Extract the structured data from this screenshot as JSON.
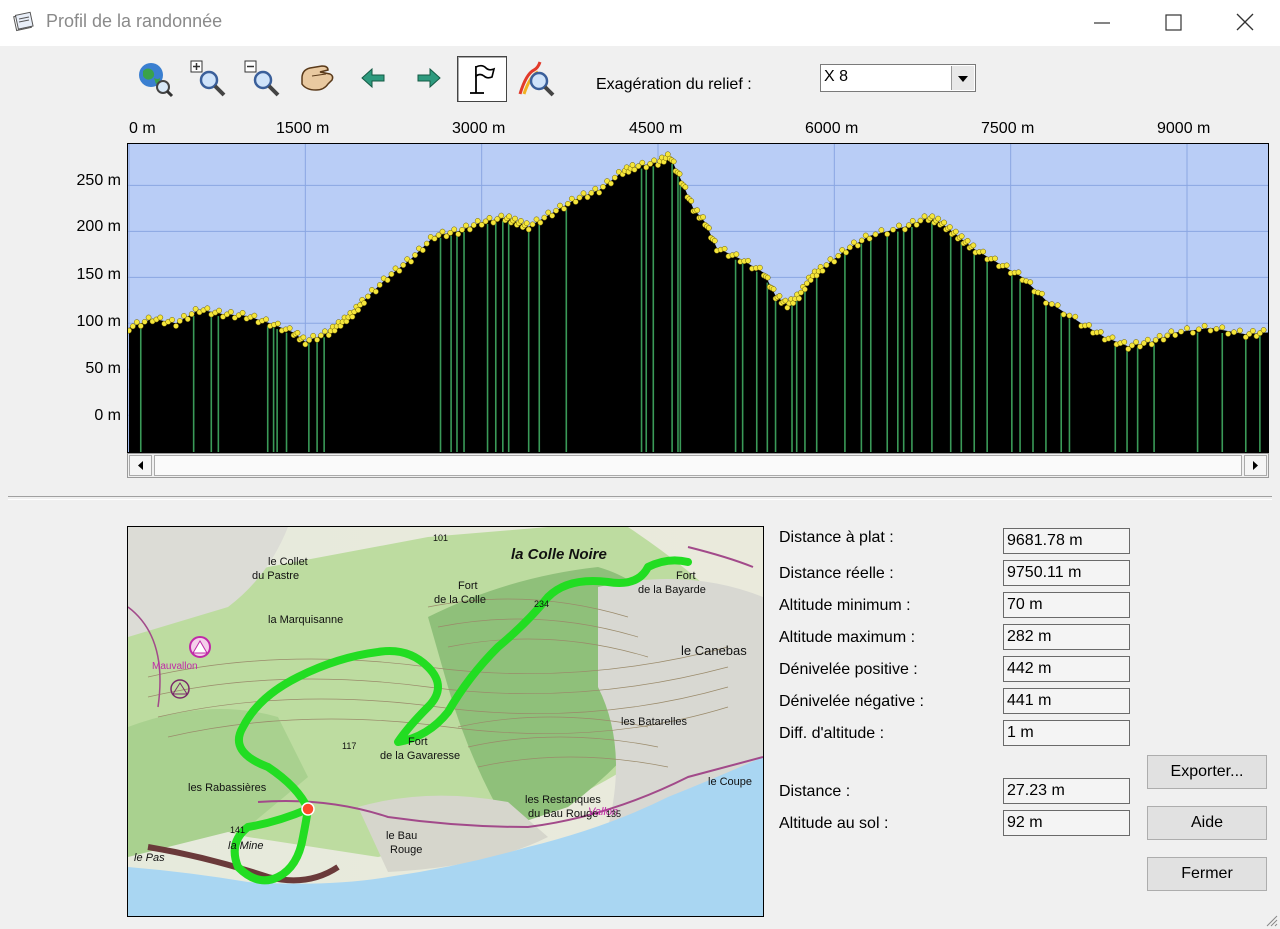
{
  "window": {
    "title": "Profil de la randonnée"
  },
  "toolbar": {
    "icons": [
      "globe-zoom-icon",
      "zoom-in-icon",
      "zoom-out-icon",
      "pan-hand-icon",
      "arrow-left-icon",
      "arrow-right-icon",
      "flag-icon",
      "path-search-icon"
    ],
    "relief_label": "Exagération du relief :",
    "relief_value": "X 8"
  },
  "profile": {
    "x_ticks": [
      "0 m",
      "1500 m",
      "3000 m",
      "4500 m",
      "6000 m",
      "7500 m",
      "9000 m"
    ],
    "y_ticks": [
      "250 m",
      "200 m",
      "150 m",
      "100 m",
      "50 m",
      "0 m"
    ]
  },
  "chart_data": {
    "type": "area",
    "xlabel": "",
    "ylabel": "",
    "xlim": [
      0,
      9681.78
    ],
    "ylim": [
      -40,
      295
    ],
    "x_ticks": [
      0,
      1500,
      3000,
      4500,
      6000,
      7500,
      9000
    ],
    "y_ticks": [
      0,
      50,
      100,
      150,
      200,
      250
    ],
    "grid": true,
    "x": [
      0,
      200,
      400,
      600,
      800,
      1000,
      1200,
      1400,
      1500,
      1700,
      1800,
      1900,
      2000,
      2200,
      2400,
      2600,
      2800,
      3000,
      3200,
      3300,
      3400,
      3600,
      3800,
      4000,
      4200,
      4300,
      4500,
      4600,
      4700,
      4800,
      4900,
      5000,
      5200,
      5400,
      5500,
      5600,
      5700,
      5800,
      5900,
      6100,
      6300,
      6600,
      6800,
      6900,
      7000,
      7100,
      7200,
      7400,
      7600,
      7800,
      8100,
      8300,
      8500,
      8700,
      8900,
      9200,
      9500,
      9681.78
    ],
    "y": [
      95,
      105,
      100,
      115,
      110,
      108,
      100,
      90,
      80,
      90,
      100,
      110,
      125,
      150,
      170,
      195,
      200,
      210,
      215,
      210,
      205,
      220,
      235,
      245,
      265,
      270,
      275,
      282,
      255,
      225,
      210,
      182,
      170,
      155,
      130,
      120,
      130,
      150,
      160,
      180,
      195,
      205,
      215,
      210,
      200,
      190,
      180,
      165,
      150,
      125,
      100,
      85,
      75,
      80,
      90,
      95,
      88,
      90
    ],
    "series": [
      {
        "values": [
          95,
          105,
          100,
          115,
          110,
          108,
          100,
          90,
          80,
          90,
          100,
          110,
          125,
          150,
          170,
          195,
          200,
          210,
          215,
          210,
          205,
          220,
          235,
          245,
          265,
          270,
          275,
          282,
          255,
          225,
          210,
          182,
          170,
          155,
          130,
          120,
          130,
          150,
          160,
          180,
          195,
          205,
          215,
          210,
          200,
          190,
          180,
          165,
          150,
          125,
          100,
          85,
          75,
          80,
          90,
          95,
          88,
          90
        ]
      }
    ],
    "markers_x": [
      100,
      550,
      700,
      760,
      1180,
      1230,
      1260,
      1340,
      1530,
      1600,
      1660,
      2650,
      2740,
      2790,
      2850,
      3050,
      3120,
      3180,
      3230,
      3400,
      3490,
      3720,
      4360,
      4400,
      4460,
      4620,
      4670,
      4690,
      5160,
      5220,
      5340,
      5430,
      5500,
      5640,
      5680,
      5750,
      5850,
      6090,
      6230,
      6310,
      6450,
      6540,
      6590,
      6660,
      6830,
      6990,
      7080,
      7190,
      7300,
      7510,
      7580,
      7690,
      7800,
      7930,
      8000,
      8390,
      8490,
      8580,
      8720,
      9090,
      9300,
      9500,
      9620
    ],
    "colors": {
      "sky": "#b9cdf6",
      "terrain": "#000000",
      "markers": "#f5e63c",
      "marker_lines": "#3a9a58",
      "grid": "#8aa6e2",
      "track": "#22dd22"
    }
  },
  "map": {
    "labels": [
      "la Colle Noire",
      "le Collet",
      "du Pastre",
      "la Marquisanne",
      "Fort",
      "de la Colle",
      "Fort",
      "de la Bayarde",
      "le Canebas",
      "Fort",
      "de la Gavaresse",
      "les Batarelles",
      "les Rabassières",
      "les Restanques",
      "du Bau Rouge",
      "le Bau",
      "Rouge",
      "le Coupe",
      "la Mine",
      "le Pas",
      "Mauvallon",
      "Vallon",
      "141",
      "101",
      "117",
      "234",
      "135"
    ]
  },
  "stats": [
    {
      "label": "Distance à plat :",
      "value": "9681.78 m"
    },
    {
      "label": "Distance réelle :",
      "value": "9750.11 m"
    },
    {
      "label": "Altitude minimum :",
      "value": "70 m"
    },
    {
      "label": "Altitude maximum :",
      "value": "282 m"
    },
    {
      "label": "Dénivelée positive :",
      "value": "442 m"
    },
    {
      "label": "Dénivelée négative :",
      "value": "441 m"
    },
    {
      "label": "Diff. d'altitude :",
      "value": "1 m"
    }
  ],
  "cursor": [
    {
      "label": "Distance :",
      "value": "27.23 m"
    },
    {
      "label": "Altitude au sol :",
      "value": "92 m"
    }
  ],
  "buttons": {
    "export": "Exporter...",
    "help": "Aide",
    "close": "Fermer"
  }
}
